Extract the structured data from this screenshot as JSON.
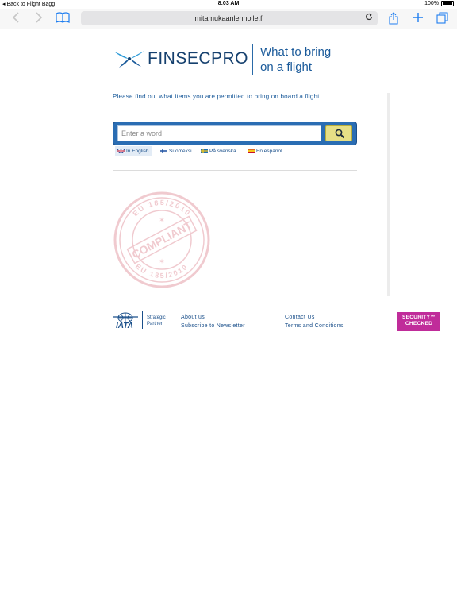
{
  "status_bar": {
    "back_label": "Back to Flight Bagg",
    "time": "8:03 AM",
    "battery_text": "100%",
    "battery_level": 1.0
  },
  "browser": {
    "url": "mitamukaanlennolle.fi",
    "icons": [
      "back-icon",
      "forward-icon",
      "bookmarks-icon",
      "reload-icon",
      "share-icon",
      "new-tab-icon",
      "tabs-icon"
    ]
  },
  "header": {
    "brand": "FINSECPRO",
    "tagline_line1": "What to bring",
    "tagline_line2": "on a flight",
    "brand_color": "#15406e",
    "accent_color": "#1a5a9a"
  },
  "intro_text": "Please find out what items you are permitted to bring on board a flight",
  "search": {
    "placeholder": "Enter a word",
    "value": "",
    "box_color": "#2a6db3",
    "button_color": "#e6df86"
  },
  "languages": [
    {
      "label": "In English",
      "flag": "uk-flag-icon",
      "active": true
    },
    {
      "label": "Suomeksi",
      "flag": "finland-flag-icon",
      "active": false
    },
    {
      "label": "På svenska",
      "flag": "sweden-flag-icon",
      "active": false
    },
    {
      "label": "En español",
      "flag": "spain-flag-icon",
      "active": false
    }
  ],
  "stamp": {
    "center_text": "COMPLIANT",
    "ring_text": "EU 185/2010"
  },
  "footer": {
    "iata_text": "IATA",
    "iata_caption_line1": "Strategic",
    "iata_caption_line2": "Partner",
    "about": "About us",
    "newsletter": "Subscribe to Newsletter",
    "contact": "Contact Us",
    "terms": "Terms and Conditions",
    "badge_line1": "SECURITY™",
    "badge_line2": "CHECKED",
    "badge_color": "#c02c9a"
  }
}
